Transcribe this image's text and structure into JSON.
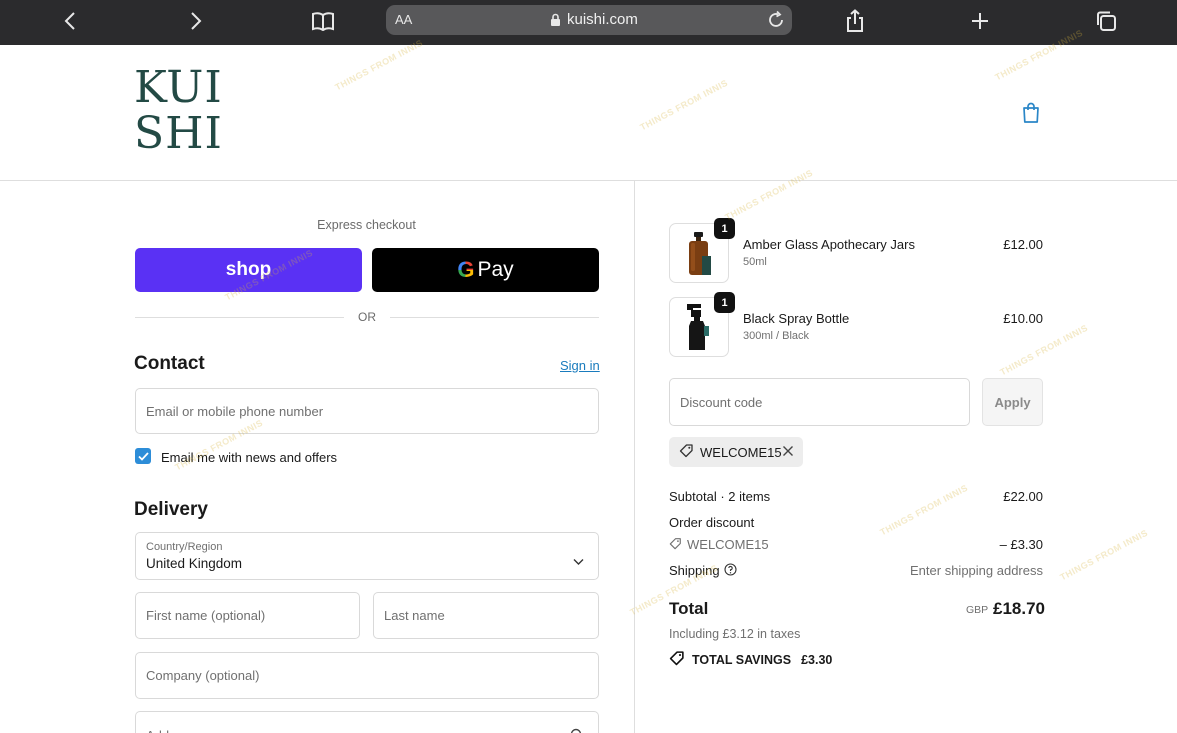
{
  "browser": {
    "aa_label": "AA",
    "url": "kuishi.com"
  },
  "brand": {
    "logo_line1": "KUI",
    "logo_line2": "SHI",
    "logo_color": "#234a45"
  },
  "express": {
    "label": "Express checkout",
    "shop_label": "shop",
    "gpay_g": "G",
    "gpay_label": "Pay",
    "or_label": "OR",
    "shop_color": "#5a31f4"
  },
  "contact": {
    "title": "Contact",
    "signin_label": "Sign in",
    "email_placeholder": "Email or mobile phone number",
    "newsletter_label": "Email me with news and offers",
    "newsletter_checked": true
  },
  "delivery": {
    "title": "Delivery",
    "country_label": "Country/Region",
    "country_value": "United Kingdom",
    "first_name_placeholder": "First name (optional)",
    "last_name_placeholder": "Last name",
    "company_placeholder": "Company (optional)",
    "address_placeholder": "Address"
  },
  "cart": {
    "items": [
      {
        "name": "Amber Glass Apothecary Jars",
        "variant": "50ml",
        "price": "£12.00",
        "qty": "1"
      },
      {
        "name": "Black Spray Bottle",
        "variant": "300ml / Black",
        "price": "£10.00",
        "qty": "1"
      }
    ]
  },
  "discount": {
    "placeholder": "Discount code",
    "apply_label": "Apply",
    "applied_code": "WELCOME15"
  },
  "summary": {
    "subtotal_label": "Subtotal · 2 items",
    "subtotal_value": "£22.00",
    "order_discount_label": "Order discount",
    "discount_code": "WELCOME15",
    "discount_value": "– £3.30",
    "shipping_label": "Shipping",
    "shipping_value": "Enter shipping address",
    "total_label": "Total",
    "total_currency": "GBP",
    "total_value": "£18.70",
    "taxes_label": "Including £3.12 in taxes",
    "savings_label": "TOTAL SAVINGS",
    "savings_value": "£3.30"
  },
  "watermark_text": "THINGS FROM INNIS"
}
